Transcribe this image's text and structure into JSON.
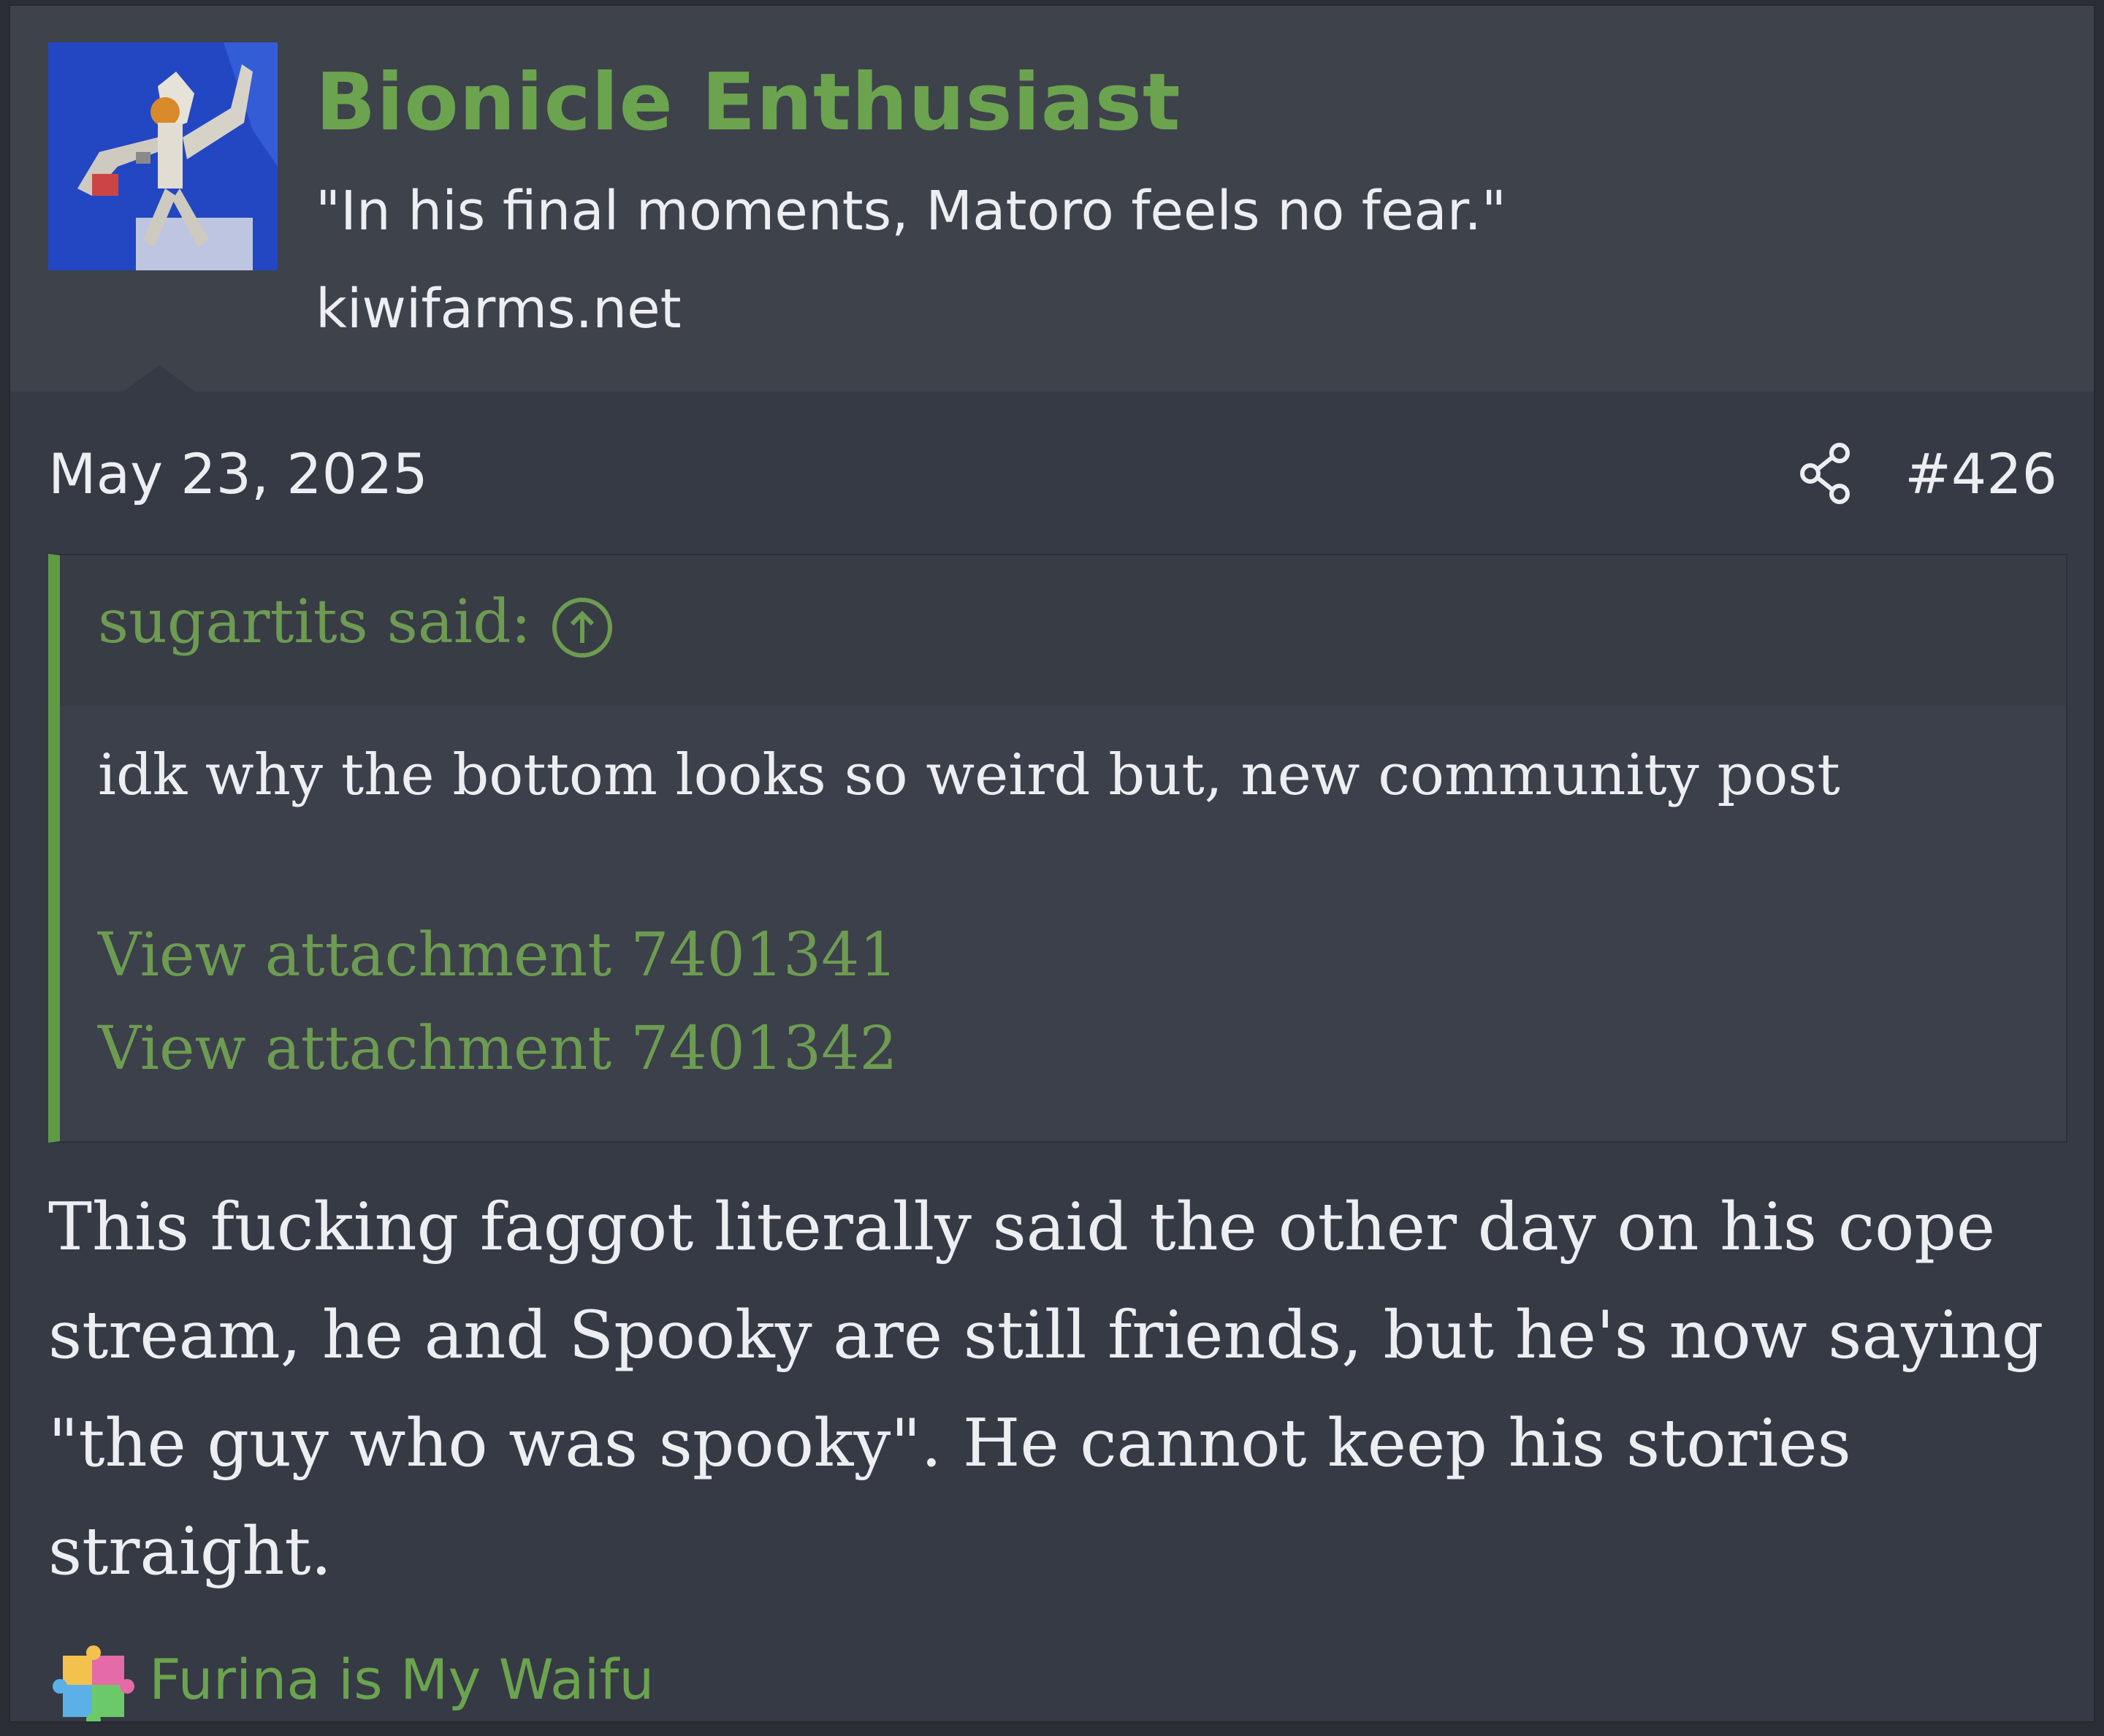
{
  "user": {
    "name": "Bionicle Enthusiast",
    "title": "\"In his final moments, Matoro feels no fear.\"",
    "site": "kiwifarms.net"
  },
  "post": {
    "date": "May 23, 2025",
    "number": "#426",
    "icons": {
      "share": "share-icon"
    }
  },
  "quote": {
    "author": "sugartits said:",
    "icon": "arrow-up-circle-icon",
    "text": "idk why the bottom looks so weird but, new community post",
    "attachments": [
      "View attachment 7401341",
      "View attachment 7401342"
    ]
  },
  "body": {
    "text": "This fucking faggot literally said the other day on his cope stream, he and Spooky are still friends, but he's now saying \"the guy who was spooky\". He cannot keep his stories straight."
  },
  "signature": {
    "text": "Furina is My Waifu",
    "icon": "puzzle-icon"
  },
  "colors": {
    "accent_green": "#6ca34f",
    "background": "#353a44",
    "header_background": "#3d424b",
    "text": "#eceef2"
  }
}
